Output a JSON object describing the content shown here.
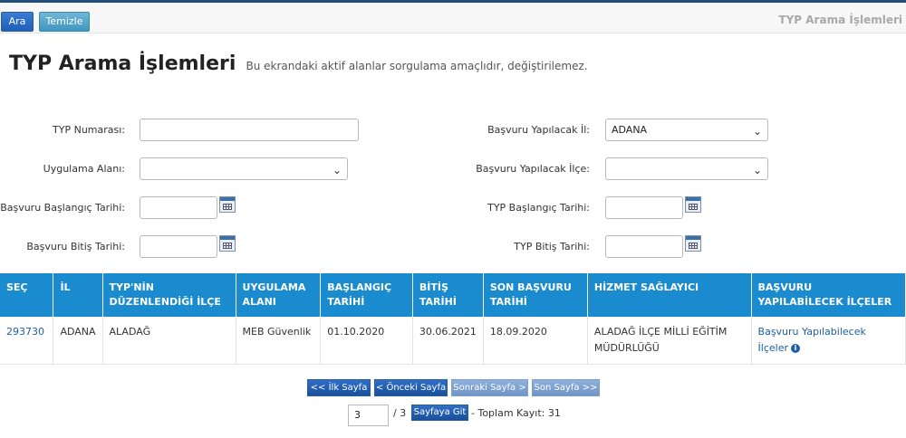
{
  "toolbar": {
    "search_label": "Ara",
    "clear_label": "Temizle",
    "title": "TYP Arama İşlemleri"
  },
  "page": {
    "title": "TYP Arama İşlemleri",
    "subtitle": "Bu ekrandaki aktif alanlar sorgulama amaçlıdır, değiştirilemez."
  },
  "form": {
    "typ_number_label": "TYP Numarası:",
    "typ_number_value": "",
    "application_area_label": "Uygulama Alanı:",
    "application_area_value": "",
    "apply_start_label": "Başvuru Başlangıç Tarihi:",
    "apply_start_value": "",
    "apply_end_label": "Başvuru Bitiş Tarihi:",
    "apply_end_value": "",
    "apply_province_label": "Başvuru Yapılacak İl:",
    "apply_province_value": "ADANA",
    "apply_district_label": "Başvuru Yapılacak İlçe:",
    "apply_district_value": "",
    "typ_start_label": "TYP Başlangıç Tarihi:",
    "typ_start_value": "",
    "typ_end_label": "TYP Bitiş Tarihi:",
    "typ_end_value": ""
  },
  "table": {
    "headers": [
      "SEÇ",
      "İL",
      "TYP'NİN DÜZENLENDİĞİ İLÇE",
      "UYGULAMA ALANI",
      "BAŞLANGIÇ TARİHİ",
      "BİTİŞ TARİHİ",
      "SON BAŞVURU TARİHİ",
      "HİZMET SAĞLAYICI",
      "BAŞVURU YAPILABİLECEK İLÇELER"
    ],
    "rows": [
      {
        "id": "293730",
        "province": "ADANA",
        "district": "ALADAĞ",
        "area": "MEB Güvenlik",
        "start": "01.10.2020",
        "end": "30.06.2021",
        "last_apply": "18.09.2020",
        "provider": "ALADAĞ İLÇE MİLLİ EĞİTİM MÜDÜRLÜĞÜ",
        "districts_link": "Başvuru Yapılabilecek İlçeler"
      }
    ]
  },
  "pagination": {
    "first": "<< İlk Sayfa",
    "prev": "< Önceki Sayfa",
    "next": "Sonraki Sayfa >",
    "last": "Son Sayfa >>",
    "current_page": "3",
    "total_pages": "/ 3",
    "go_label": "Sayfaya Git",
    "total_records": "- Toplam Kayıt: 31"
  },
  "colors": {
    "header_bg": "#1b8bd0",
    "accent": "#1f5fa6"
  }
}
